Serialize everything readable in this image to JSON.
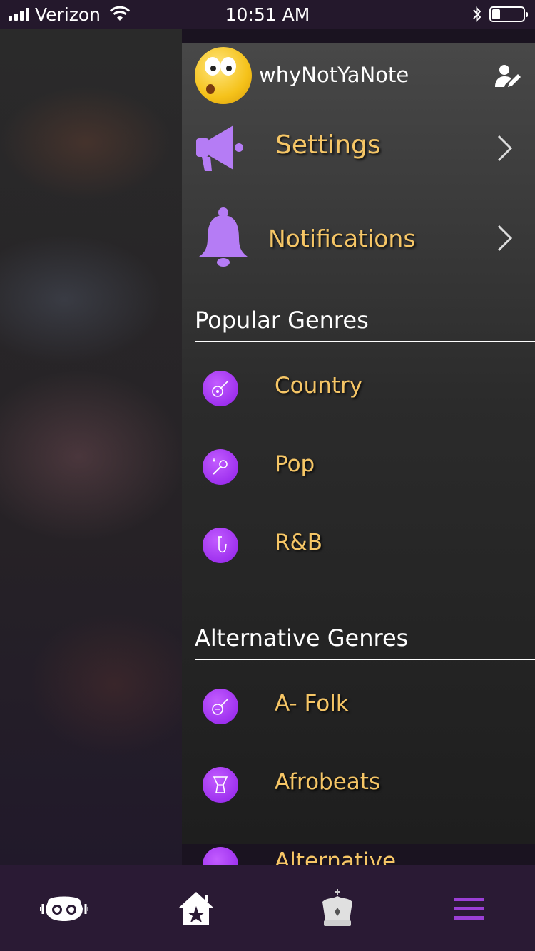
{
  "status_bar": {
    "carrier": "Verizon",
    "time": "10:51 AM",
    "battery_level": 0.25
  },
  "profile": {
    "username": "whyNotYaNote",
    "avatar_icon": "emoji-avatar",
    "edit_icon": "edit-user-icon"
  },
  "menu": {
    "settings_label": "Settings",
    "notifications_label": "Notifications"
  },
  "popular": {
    "title": "Popular Genres",
    "items": [
      {
        "label": "Country",
        "icon": "guitar-icon"
      },
      {
        "label": "Pop",
        "icon": "microphone-icon"
      },
      {
        "label": "R&B",
        "icon": "saxophone-icon"
      }
    ]
  },
  "alternative": {
    "title": "Alternative Genres",
    "items": [
      {
        "label": "A- Folk",
        "icon": "banjo-icon"
      },
      {
        "label": "Afrobeats",
        "icon": "djembe-icon"
      },
      {
        "label": "Alternative",
        "icon": "drums-icon"
      }
    ]
  },
  "tabbar": {
    "tabs": [
      "mascot-tab",
      "home-star-tab",
      "crown-tab",
      "menu-tab"
    ],
    "active": "menu-tab"
  },
  "colors": {
    "accent_purple": "#b57cf5",
    "label_gold": "#f6c666",
    "tab_active": "#9b3fd6"
  }
}
